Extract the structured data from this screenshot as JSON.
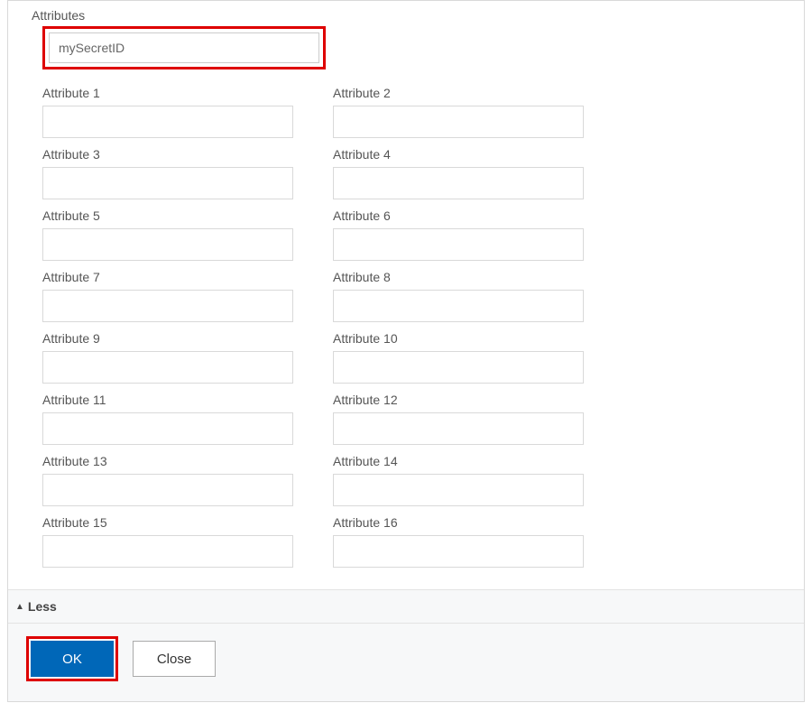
{
  "section": {
    "title": "Attributes",
    "masked_value": "mySecretID"
  },
  "attributes": [
    {
      "label": "Attribute 1",
      "value": ""
    },
    {
      "label": "Attribute 2",
      "value": ""
    },
    {
      "label": "Attribute 3",
      "value": ""
    },
    {
      "label": "Attribute 4",
      "value": ""
    },
    {
      "label": "Attribute 5",
      "value": ""
    },
    {
      "label": "Attribute 6",
      "value": ""
    },
    {
      "label": "Attribute 7",
      "value": ""
    },
    {
      "label": "Attribute 8",
      "value": ""
    },
    {
      "label": "Attribute 9",
      "value": ""
    },
    {
      "label": "Attribute 10",
      "value": ""
    },
    {
      "label": "Attribute 11",
      "value": ""
    },
    {
      "label": "Attribute 12",
      "value": ""
    },
    {
      "label": "Attribute 13",
      "value": ""
    },
    {
      "label": "Attribute 14",
      "value": ""
    },
    {
      "label": "Attribute 15",
      "value": ""
    },
    {
      "label": "Attribute 16",
      "value": ""
    }
  ],
  "toggle": {
    "label": "Less"
  },
  "footer": {
    "ok_label": "OK",
    "close_label": "Close"
  }
}
